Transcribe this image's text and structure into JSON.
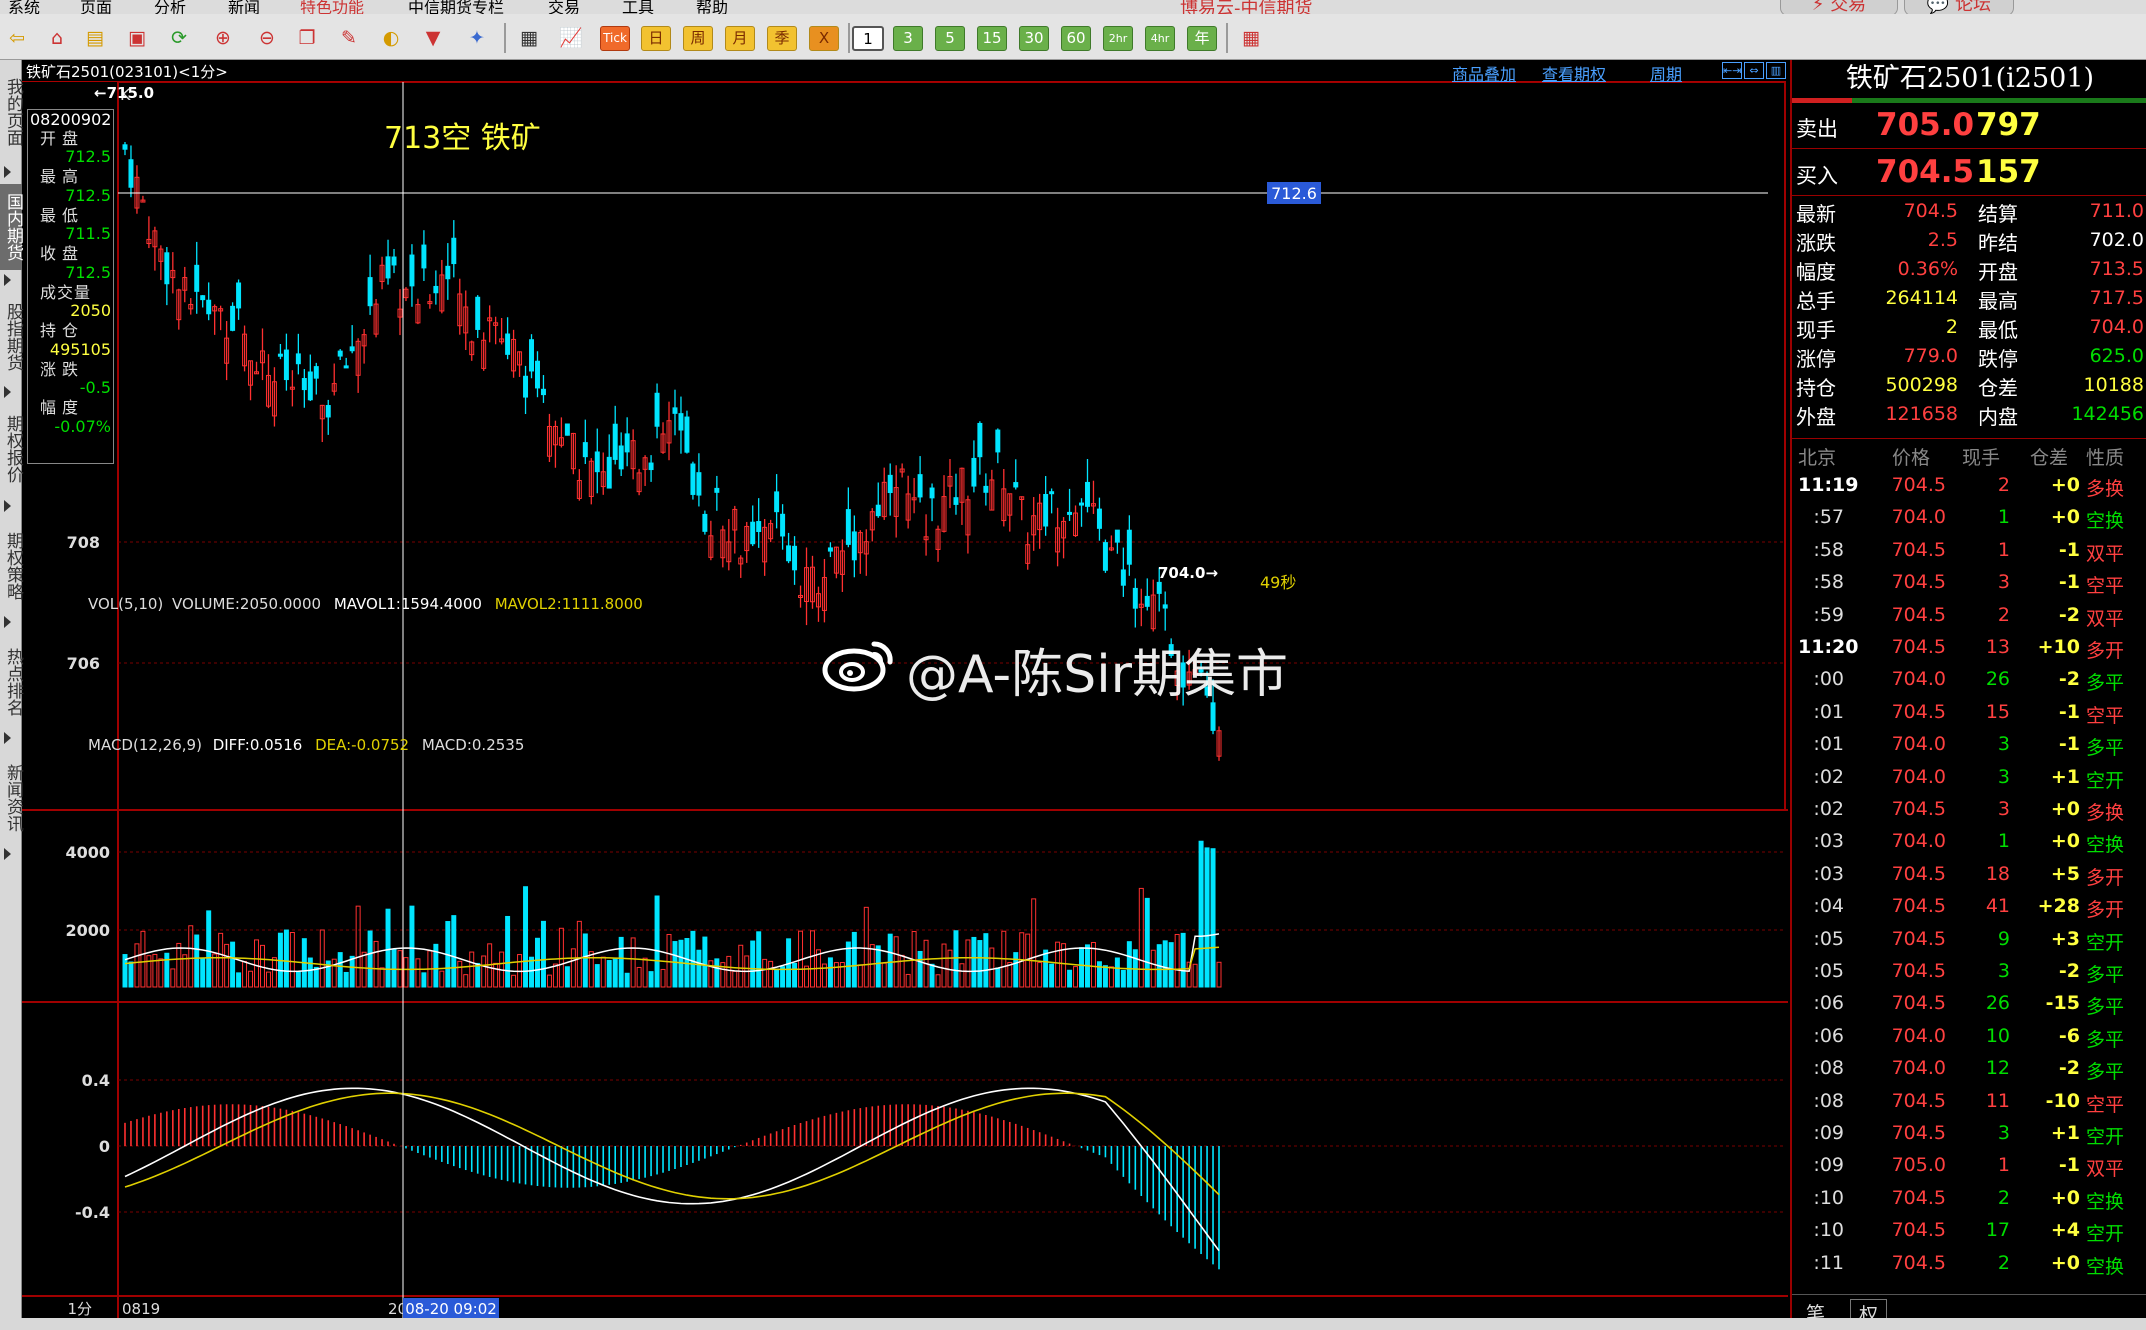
{
  "menubar": {
    "items": [
      "系统",
      "页面",
      "分析",
      "新闻",
      "特色功能",
      "中信期货专栏",
      "交易",
      "工具",
      "帮助"
    ],
    "app_title": "博易云-中信期货",
    "trade_button": "交易",
    "forum_button": "论坛"
  },
  "toolbar": {
    "periods": [
      "日",
      "周",
      "月",
      "季",
      "年"
    ],
    "minutes": [
      "1",
      "3",
      "5",
      "15",
      "30",
      "60",
      "2hr",
      "4hr"
    ]
  },
  "left_tabs": [
    "我的页面",
    "国内期货",
    "股指期货",
    "期权报价",
    "期权策略",
    "热点排名",
    "新闻资讯"
  ],
  "chart_header": {
    "title": "铁矿石2501(023101)<1分>",
    "links": [
      "商品叠加",
      "查看期权",
      "周期"
    ]
  },
  "info_box": {
    "date": "08200902",
    "open_label": "开盘",
    "open": "712.5",
    "high_label": "最高",
    "high": "712.5",
    "low_label": "最低",
    "low": "711.5",
    "close_label": "收盘",
    "close": "712.5",
    "volume_label": "成交量",
    "volume": "2050",
    "oi_label": "持仓",
    "oi": "495105",
    "change_label": "涨跌",
    "change": "-0.5",
    "pct_label": "幅度",
    "pct": "-0.07%"
  },
  "main_chart": {
    "panel_label": "K",
    "high_marker": "715.0",
    "low_marker": "704.0",
    "annotation": "713空 铁矿",
    "crosshair_price": "712.6",
    "price_ticks": [
      "708",
      "706"
    ],
    "timer": "49秒",
    "crosshair_time": "08-20 09:02",
    "start_date": "0819",
    "axis_prefix": "20",
    "period_label": "1分"
  },
  "volume_panel": {
    "title": "VOL(5,10)",
    "volume": "VOLUME:2050.0000",
    "mavol1": "MAVOL1:1594.4000",
    "mavol2": "MAVOL2:1111.8000",
    "ticks": [
      "4000",
      "2000"
    ]
  },
  "macd_panel": {
    "title": "MACD(12,26,9)",
    "diff": "DIFF:0.0516",
    "dea": "DEA:-0.0752",
    "macd": "MACD:0.2535",
    "ticks": [
      "0.4",
      "0",
      "-0.4"
    ]
  },
  "watermark": "@A-陈Sir期集市",
  "quote": {
    "title": "铁矿石2501(i2501)",
    "ask_label": "卖出",
    "ask_price": "705.0",
    "ask_vol": "797",
    "bid_label": "买入",
    "bid_price": "704.5",
    "bid_vol": "157",
    "rows": [
      {
        "l1": "最新",
        "v1": "704.5",
        "c1": "r",
        "l2": "结算",
        "v2": "711.0",
        "c2": "r"
      },
      {
        "l1": "涨跌",
        "v1": "2.5",
        "c1": "r",
        "l2": "昨结",
        "v2": "702.0",
        "c2": "w"
      },
      {
        "l1": "幅度",
        "v1": "0.36%",
        "c1": "r",
        "l2": "开盘",
        "v2": "713.5",
        "c2": "r"
      },
      {
        "l1": "总手",
        "v1": "264114",
        "c1": "y",
        "l2": "最高",
        "v2": "717.5",
        "c2": "r"
      },
      {
        "l1": "现手",
        "v1": "2",
        "c1": "y",
        "l2": "最低",
        "v2": "704.0",
        "c2": "r"
      },
      {
        "l1": "涨停",
        "v1": "779.0",
        "c1": "r",
        "l2": "跌停",
        "v2": "625.0",
        "c2": "g"
      },
      {
        "l1": "持仓",
        "v1": "500298",
        "c1": "y",
        "l2": "仓差",
        "v2": "10188",
        "c2": "y"
      },
      {
        "l1": "外盘",
        "v1": "121658",
        "c1": "r",
        "l2": "内盘",
        "v2": "142456",
        "c2": "g"
      }
    ],
    "tick_headers": [
      "北京",
      "价格",
      "现手",
      "仓差",
      "性质"
    ],
    "ticks": [
      {
        "t": "11:19",
        "full": true,
        "p": "704.5",
        "pc": "r",
        "v": "2",
        "vc": "r",
        "o": "+0",
        "oc": "y",
        "k": "多换",
        "kc": "r"
      },
      {
        "t": ":57",
        "full": false,
        "p": "704.0",
        "pc": "r",
        "v": "1",
        "vc": "g",
        "o": "+0",
        "oc": "y",
        "k": "空换",
        "kc": "g"
      },
      {
        "t": ":58",
        "full": false,
        "p": "704.5",
        "pc": "r",
        "v": "1",
        "vc": "r",
        "o": "-1",
        "oc": "y",
        "k": "双平",
        "kc": "r"
      },
      {
        "t": ":58",
        "full": false,
        "p": "704.5",
        "pc": "r",
        "v": "3",
        "vc": "r",
        "o": "-1",
        "oc": "y",
        "k": "空平",
        "kc": "r"
      },
      {
        "t": ":59",
        "full": false,
        "p": "704.5",
        "pc": "r",
        "v": "2",
        "vc": "r",
        "o": "-2",
        "oc": "y",
        "k": "双平",
        "kc": "r"
      },
      {
        "t": "11:20",
        "full": true,
        "p": "704.5",
        "pc": "r",
        "v": "13",
        "vc": "r",
        "o": "+10",
        "oc": "y",
        "k": "多开",
        "kc": "r"
      },
      {
        "t": ":00",
        "full": false,
        "p": "704.0",
        "pc": "r",
        "v": "26",
        "vc": "g",
        "o": "-2",
        "oc": "y",
        "k": "多平",
        "kc": "g"
      },
      {
        "t": ":01",
        "full": false,
        "p": "704.5",
        "pc": "r",
        "v": "15",
        "vc": "r",
        "o": "-1",
        "oc": "y",
        "k": "空平",
        "kc": "r"
      },
      {
        "t": ":01",
        "full": false,
        "p": "704.0",
        "pc": "r",
        "v": "3",
        "vc": "g",
        "o": "-1",
        "oc": "y",
        "k": "多平",
        "kc": "g"
      },
      {
        "t": ":02",
        "full": false,
        "p": "704.0",
        "pc": "r",
        "v": "3",
        "vc": "g",
        "o": "+1",
        "oc": "y",
        "k": "空开",
        "kc": "g"
      },
      {
        "t": ":02",
        "full": false,
        "p": "704.5",
        "pc": "r",
        "v": "3",
        "vc": "r",
        "o": "+0",
        "oc": "y",
        "k": "多换",
        "kc": "r"
      },
      {
        "t": ":03",
        "full": false,
        "p": "704.0",
        "pc": "r",
        "v": "1",
        "vc": "g",
        "o": "+0",
        "oc": "y",
        "k": "空换",
        "kc": "g"
      },
      {
        "t": ":03",
        "full": false,
        "p": "704.5",
        "pc": "r",
        "v": "18",
        "vc": "r",
        "o": "+5",
        "oc": "y",
        "k": "多开",
        "kc": "r"
      },
      {
        "t": ":04",
        "full": false,
        "p": "704.5",
        "pc": "r",
        "v": "41",
        "vc": "r",
        "o": "+28",
        "oc": "y",
        "k": "多开",
        "kc": "r"
      },
      {
        "t": ":05",
        "full": false,
        "p": "704.5",
        "pc": "r",
        "v": "9",
        "vc": "g",
        "o": "+3",
        "oc": "y",
        "k": "空开",
        "kc": "g"
      },
      {
        "t": ":05",
        "full": false,
        "p": "704.5",
        "pc": "r",
        "v": "3",
        "vc": "g",
        "o": "-2",
        "oc": "y",
        "k": "多平",
        "kc": "g"
      },
      {
        "t": ":06",
        "full": false,
        "p": "704.5",
        "pc": "r",
        "v": "26",
        "vc": "g",
        "o": "-15",
        "oc": "y",
        "k": "多平",
        "kc": "g"
      },
      {
        "t": ":06",
        "full": false,
        "p": "704.0",
        "pc": "r",
        "v": "10",
        "vc": "g",
        "o": "-6",
        "oc": "y",
        "k": "多平",
        "kc": "g"
      },
      {
        "t": ":08",
        "full": false,
        "p": "704.0",
        "pc": "r",
        "v": "12",
        "vc": "g",
        "o": "-2",
        "oc": "y",
        "k": "多平",
        "kc": "g"
      },
      {
        "t": ":08",
        "full": false,
        "p": "704.5",
        "pc": "r",
        "v": "11",
        "vc": "r",
        "o": "-10",
        "oc": "y",
        "k": "空平",
        "kc": "r"
      },
      {
        "t": ":09",
        "full": false,
        "p": "704.5",
        "pc": "r",
        "v": "3",
        "vc": "g",
        "o": "+1",
        "oc": "y",
        "k": "空开",
        "kc": "g"
      },
      {
        "t": ":09",
        "full": false,
        "p": "705.0",
        "pc": "r",
        "v": "1",
        "vc": "r",
        "o": "-1",
        "oc": "y",
        "k": "双平",
        "kc": "r"
      },
      {
        "t": ":10",
        "full": false,
        "p": "704.5",
        "pc": "r",
        "v": "2",
        "vc": "g",
        "o": "+0",
        "oc": "y",
        "k": "空换",
        "kc": "g"
      },
      {
        "t": ":10",
        "full": false,
        "p": "704.5",
        "pc": "r",
        "v": "17",
        "vc": "g",
        "o": "+4",
        "oc": "y",
        "k": "空开",
        "kc": "g"
      },
      {
        "t": ":11",
        "full": false,
        "p": "704.5",
        "pc": "r",
        "v": "2",
        "vc": "g",
        "o": "+0",
        "oc": "y",
        "k": "空换",
        "kc": "g"
      }
    ],
    "tabs": [
      "笔",
      "权"
    ]
  }
}
